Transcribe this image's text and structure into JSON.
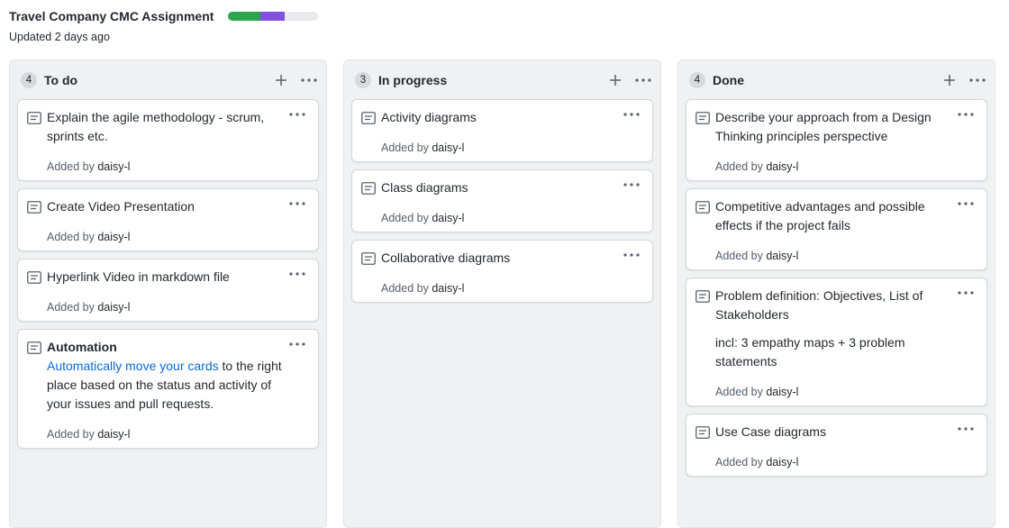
{
  "project": {
    "title": "Travel Company CMC Assignment",
    "updated": "Updated 2 days ago",
    "progress": {
      "done_color": "#2da44e",
      "in_progress_color": "#8250df",
      "track_color": "#e8eaee",
      "done_fraction": 0.36,
      "in_progress_fraction": 0.27
    }
  },
  "columns": [
    {
      "count": "4",
      "title": "To do",
      "cards": [
        {
          "title": "Explain the agile methodology - scrum, sprints etc.",
          "added_prefix": "Added by",
          "user": "daisy-l"
        },
        {
          "title": "Create Video Presentation",
          "added_prefix": "Added by",
          "user": "daisy-l"
        },
        {
          "title": "Hyperlink Video in markdown file",
          "added_prefix": "Added by",
          "user": "daisy-l"
        },
        {
          "title": "Automation",
          "link": "Automatically move your cards",
          "text": "to the right place based on the status and activity of your issues and pull requests.",
          "added_prefix": "Added by",
          "user": "daisy-l"
        }
      ]
    },
    {
      "count": "3",
      "title": "In progress",
      "cards": [
        {
          "title": "Activity diagrams",
          "added_prefix": "Added by",
          "user": "daisy-l"
        },
        {
          "title": "Class diagrams",
          "added_prefix": "Added by",
          "user": "daisy-l"
        },
        {
          "title": "Collaborative diagrams",
          "added_prefix": "Added by",
          "user": "daisy-l"
        }
      ]
    },
    {
      "count": "4",
      "title": "Done",
      "cards": [
        {
          "title": "Describe your approach from a Design Thinking principles perspective",
          "added_prefix": "Added by",
          "user": "daisy-l"
        },
        {
          "title": "Competitive advantages and possible effects if the project fails",
          "added_prefix": "Added by",
          "user": "daisy-l"
        },
        {
          "title": "Problem definition: Objectives, List of Stakeholders",
          "note": "incl: 3 empathy maps + 3 problem statements",
          "added_prefix": "Added by",
          "user": "daisy-l"
        },
        {
          "title": "Use Case diagrams",
          "added_prefix": "Added by",
          "user": "daisy-l"
        }
      ]
    }
  ],
  "icons": {
    "note": "note-icon",
    "add": "plus-icon",
    "menu": "kebab-menu-icon"
  }
}
